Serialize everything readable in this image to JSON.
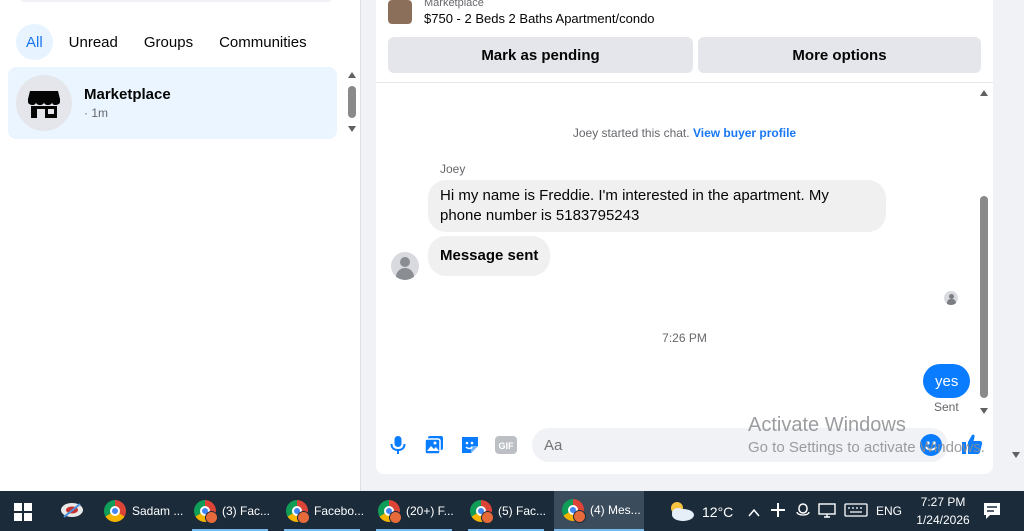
{
  "filters": {
    "tabs": [
      {
        "label": "All",
        "active": true
      },
      {
        "label": "Unread"
      },
      {
        "label": "Groups"
      },
      {
        "label": "Communities"
      }
    ]
  },
  "chat_list": {
    "items": [
      {
        "name": "Marketplace",
        "time": "· 1m",
        "icon": "storefront-icon"
      }
    ]
  },
  "header": {
    "listing_kicker": "Marketplace",
    "listing_title": "$750 - 2 Beds 2 Baths Apartment/condo",
    "mark_pending_label": "Mark as pending",
    "more_options_label": "More options"
  },
  "conversation": {
    "started_text": "Joey started this chat.",
    "view_buyer_profile": "View buyer profile",
    "sender_name": "Joey",
    "incoming": [
      "Hi my name is Freddie. I'm interested in the apartment. My phone number is 5183795243",
      "Message sent"
    ],
    "time_divider": "7:26 PM",
    "outgoing": {
      "text": "yes",
      "status": "Sent"
    }
  },
  "composer": {
    "placeholder": "Aa",
    "icons": [
      "microphone-icon",
      "photo-icon",
      "sticker-icon",
      "gif-icon",
      "emoji-icon",
      "thumbs-up-icon"
    ],
    "gif_label": "GIF"
  },
  "watermark": {
    "line1": "Activate Windows",
    "line2": "Go to Settings to activate Windows."
  },
  "taskbar": {
    "apps": [
      {
        "label": "Sadam ..."
      },
      {
        "label": "(3) Fac..."
      },
      {
        "label": "Facebo..."
      },
      {
        "label": "(20+) F..."
      },
      {
        "label": "(5) Fac..."
      },
      {
        "label": "(4) Mes...",
        "active": true
      }
    ],
    "weather": "12°C",
    "language": "ENG",
    "time": "7:27 PM",
    "date": "1/24/2026"
  },
  "colors": {
    "accent": "#0a7cff",
    "facebook_blue": "#1877f2",
    "selected_chat_bg": "#ebf5ff",
    "taskbar_bg": "#1b2b3a"
  }
}
